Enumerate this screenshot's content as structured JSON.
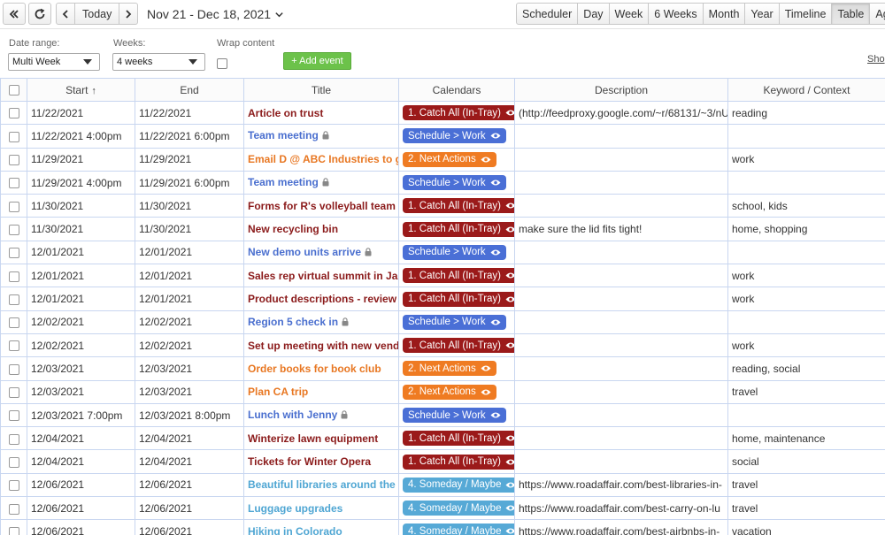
{
  "toolbar": {
    "icons": [
      "double-chevron-left-icon",
      "refresh-icon",
      "chevron-left-icon",
      "chevron-right-icon",
      "chevron-down-icon"
    ],
    "today_label": "Today",
    "date_range_title": "Nov 21 - Dec 18, 2021",
    "views": [
      "Scheduler",
      "Day",
      "Week",
      "6 Weeks",
      "Month",
      "Year",
      "Timeline",
      "Table",
      "Agen"
    ],
    "active_view": "Table"
  },
  "filters": {
    "date_range_label": "Date range:",
    "date_range_value": "Multi Week",
    "weeks_label": "Weeks:",
    "weeks_value": "4 weeks",
    "wrap_label": "Wrap content",
    "add_event_label": "+ Add event",
    "show_label": "Sho"
  },
  "table": {
    "headers": {
      "start": "Start",
      "end": "End",
      "title": "Title",
      "calendars": "Calendars",
      "description": "Description",
      "keyword": "Keyword / Context"
    },
    "sort_indicator": "↑",
    "calendar_colors": {
      "catch": "#9b1a1a",
      "sched": "#4a6fd6",
      "next": "#ef7b22",
      "some": "#56a9d6"
    },
    "rows": [
      {
        "start": "11/22/2021",
        "end": "11/22/2021",
        "title": "Article on trust",
        "cal": "1. Catch All (In-Tray)",
        "kind": "catch",
        "lock": false,
        "desc": "(http://feedproxy.google.com/~r/68131/~3/nU",
        "kw": "reading"
      },
      {
        "start": "11/22/2021 4:00pm",
        "end": "11/22/2021 6:00pm",
        "title": "Team meeting",
        "cal": "Schedule > Work",
        "kind": "sched",
        "lock": true,
        "desc": "",
        "kw": ""
      },
      {
        "start": "11/29/2021",
        "end": "11/29/2021",
        "title": "Email D @ ABC Industries to get",
        "cal": "2. Next Actions",
        "kind": "next",
        "lock": false,
        "desc": "",
        "kw": "work"
      },
      {
        "start": "11/29/2021 4:00pm",
        "end": "11/29/2021 6:00pm",
        "title": "Team meeting",
        "cal": "Schedule > Work",
        "kind": "sched",
        "lock": true,
        "desc": "",
        "kw": ""
      },
      {
        "start": "11/30/2021",
        "end": "11/30/2021",
        "title": "Forms for R's volleyball team",
        "cal": "1. Catch All (In-Tray)",
        "kind": "catch",
        "lock": false,
        "desc": "",
        "kw": "school, kids"
      },
      {
        "start": "11/30/2021",
        "end": "11/30/2021",
        "title": "New recycling bin",
        "cal": "1. Catch All (In-Tray)",
        "kind": "catch",
        "lock": false,
        "desc": "make sure the lid fits tight!",
        "kw": "home, shopping"
      },
      {
        "start": "12/01/2021",
        "end": "12/01/2021",
        "title": "New demo units arrive",
        "cal": "Schedule > Work",
        "kind": "sched",
        "lock": true,
        "desc": "",
        "kw": ""
      },
      {
        "start": "12/01/2021",
        "end": "12/01/2021",
        "title": "Sales rep virtual summit in Janu",
        "cal": "1. Catch All (In-Tray)",
        "kind": "catch",
        "lock": false,
        "desc": "",
        "kw": "work"
      },
      {
        "start": "12/01/2021",
        "end": "12/01/2021",
        "title": "Product descriptions - review fi",
        "cal": "1. Catch All (In-Tray)",
        "kind": "catch",
        "lock": false,
        "desc": "",
        "kw": "work"
      },
      {
        "start": "12/02/2021",
        "end": "12/02/2021",
        "title": "Region 5 check in",
        "cal": "Schedule > Work",
        "kind": "sched",
        "lock": true,
        "desc": "",
        "kw": ""
      },
      {
        "start": "12/02/2021",
        "end": "12/02/2021",
        "title": "Set up meeting with new vendo",
        "cal": "1. Catch All (In-Tray)",
        "kind": "catch",
        "lock": false,
        "desc": "",
        "kw": "work"
      },
      {
        "start": "12/03/2021",
        "end": "12/03/2021",
        "title": "Order books for book club",
        "cal": "2. Next Actions",
        "kind": "next",
        "lock": false,
        "desc": "",
        "kw": "reading, social"
      },
      {
        "start": "12/03/2021",
        "end": "12/03/2021",
        "title": "Plan CA trip",
        "cal": "2. Next Actions",
        "kind": "next",
        "lock": false,
        "desc": "",
        "kw": "travel"
      },
      {
        "start": "12/03/2021 7:00pm",
        "end": "12/03/2021 8:00pm",
        "title": "Lunch with Jenny",
        "cal": "Schedule > Work",
        "kind": "sched",
        "lock": true,
        "desc": "",
        "kw": ""
      },
      {
        "start": "12/04/2021",
        "end": "12/04/2021",
        "title": "Winterize lawn equipment",
        "cal": "1. Catch All (In-Tray)",
        "kind": "catch",
        "lock": false,
        "desc": "",
        "kw": "home, maintenance"
      },
      {
        "start": "12/04/2021",
        "end": "12/04/2021",
        "title": "Tickets for Winter Opera",
        "cal": "1. Catch All (In-Tray)",
        "kind": "catch",
        "lock": false,
        "desc": "",
        "kw": "social"
      },
      {
        "start": "12/06/2021",
        "end": "12/06/2021",
        "title": "Beautiful libraries around the w",
        "cal": "4. Someday / Maybe",
        "kind": "some",
        "lock": false,
        "desc": "https://www.roadaffair.com/best-libraries-in-",
        "kw": "travel"
      },
      {
        "start": "12/06/2021",
        "end": "12/06/2021",
        "title": "Luggage upgrades",
        "cal": "4. Someday / Maybe",
        "kind": "some",
        "lock": false,
        "desc": "https://www.roadaffair.com/best-carry-on-lu",
        "kw": "travel"
      },
      {
        "start": "12/06/2021",
        "end": "12/06/2021",
        "title": "Hiking in Colorado",
        "cal": "4. Someday / Maybe",
        "kind": "some",
        "lock": false,
        "desc": "https://www.roadaffair.com/best-airbnbs-in-",
        "kw": "vacation"
      }
    ]
  }
}
